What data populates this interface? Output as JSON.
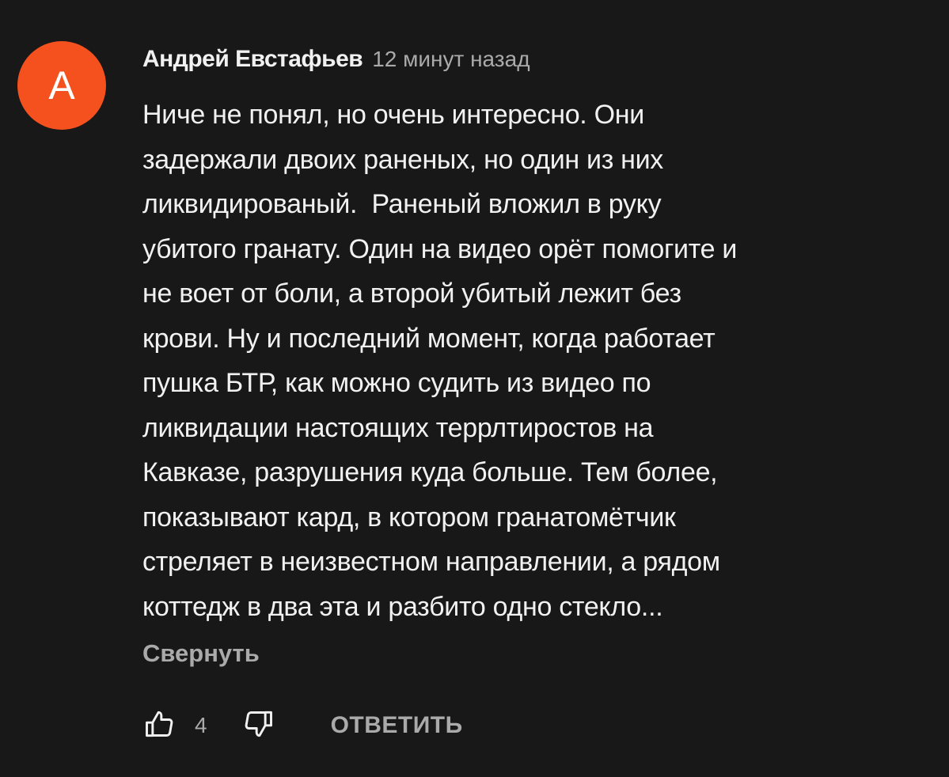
{
  "comment": {
    "avatar_letter": "А",
    "avatar_color": "#f4511e",
    "author": "Андрей Евстафьев",
    "time": "12 минут назад",
    "text_lines": [
      "Ниче не понял, но очень интересно. Они",
      "задержали двоих раненых, но один из них",
      "ликвидированый.  Раненый вложил в руку",
      "убитого гранату. Один на видео орёт помогите и",
      "не воет от боли, а второй убитый лежит без",
      "крови. Ну и последний момент, когда работает",
      "пушка БТР, как можно судить из видео по",
      "ликвидации настоящих террлтиростов на",
      "Кавказе, разрушения куда больше. Тем более,",
      "показывают кард, в котором гранатомётчик",
      "стреляет в неизвестном направлении, а рядом",
      "коттедж в два эта и разбито одно стекло..."
    ],
    "collapse_label": "Свернуть",
    "like_icon": "thumbs-up-icon",
    "like_count": "4",
    "dislike_icon": "thumbs-down-icon",
    "reply_label": "ОТВЕТИТЬ"
  },
  "colors": {
    "background": "#181818",
    "text_primary": "#f1f1f1",
    "text_secondary": "#aaaaaa"
  }
}
